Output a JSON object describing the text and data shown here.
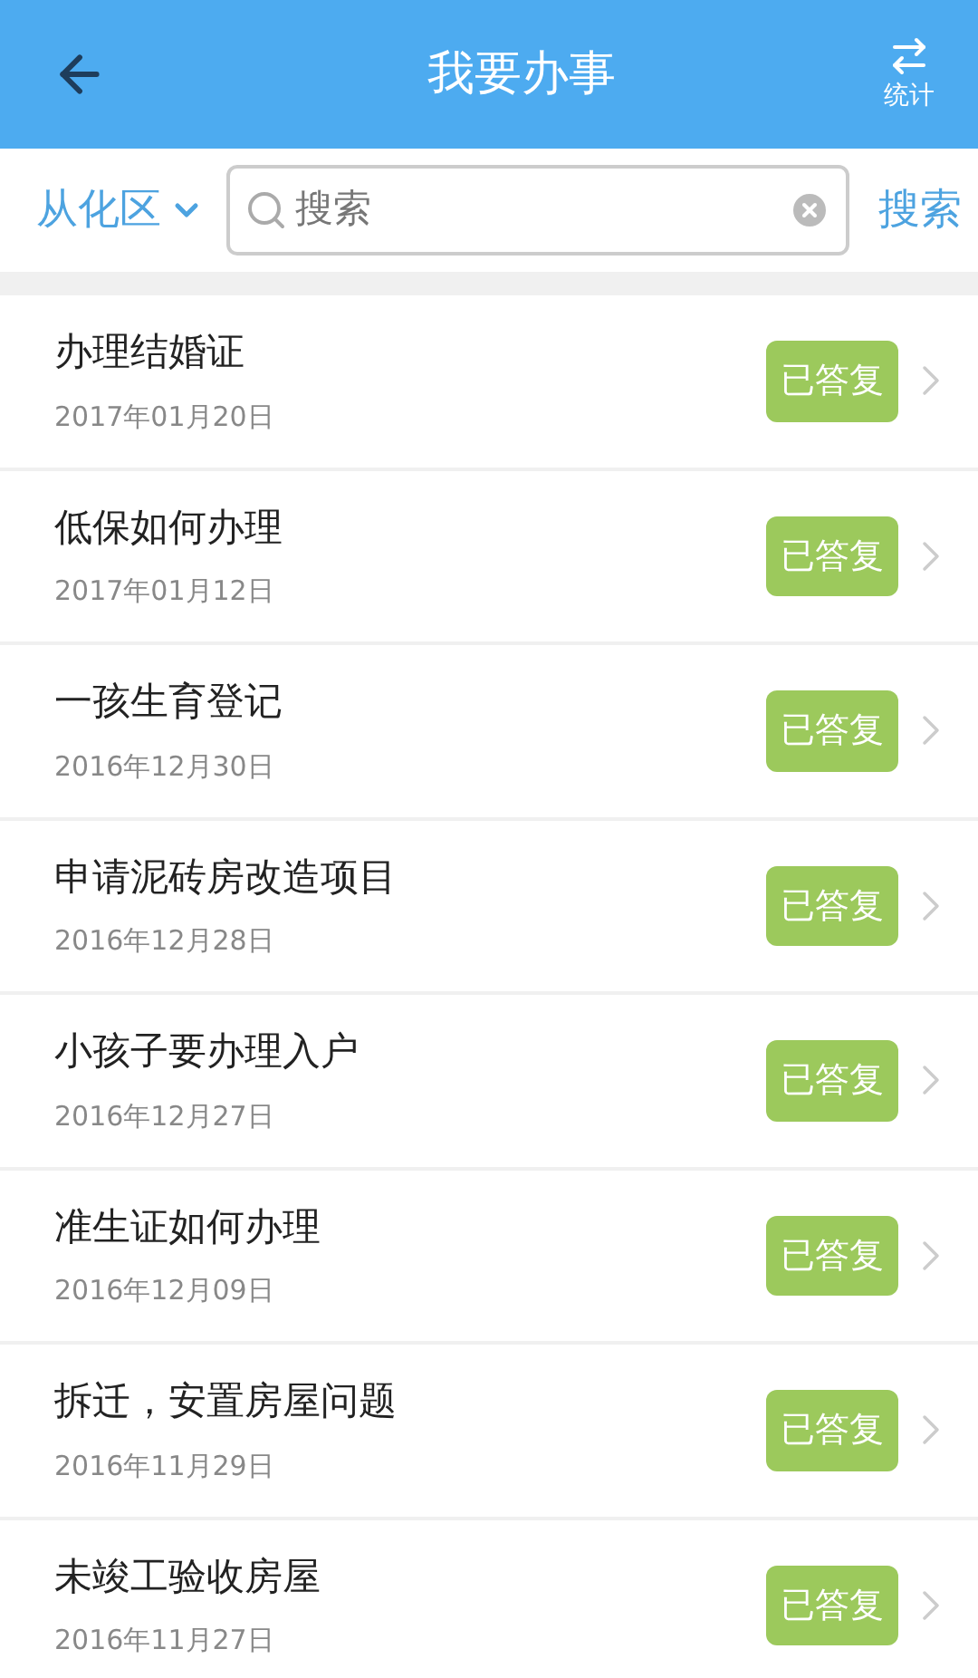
{
  "header": {
    "title": "我要办事",
    "stats_label": "统计"
  },
  "filter": {
    "district": "从化区",
    "search_placeholder": "搜索",
    "search_button": "搜索"
  },
  "items": [
    {
      "title": "办理结婚证",
      "date": "2017年01月20日",
      "status": "已答复"
    },
    {
      "title": "低保如何办理",
      "date": "2017年01月12日",
      "status": "已答复"
    },
    {
      "title": "一孩生育登记",
      "date": "2016年12月30日",
      "status": "已答复"
    },
    {
      "title": "申请泥砖房改造项目",
      "date": "2016年12月28日",
      "status": "已答复"
    },
    {
      "title": "小孩子要办理入户",
      "date": "2016年12月27日",
      "status": "已答复"
    },
    {
      "title": "准生证如何办理",
      "date": "2016年12月09日",
      "status": "已答复"
    },
    {
      "title": "拆迁，安置房屋问题",
      "date": "2016年11月29日",
      "status": "已答复"
    },
    {
      "title": "未竣工验收房屋",
      "date": "2016年11月27日",
      "status": "已答复"
    }
  ]
}
